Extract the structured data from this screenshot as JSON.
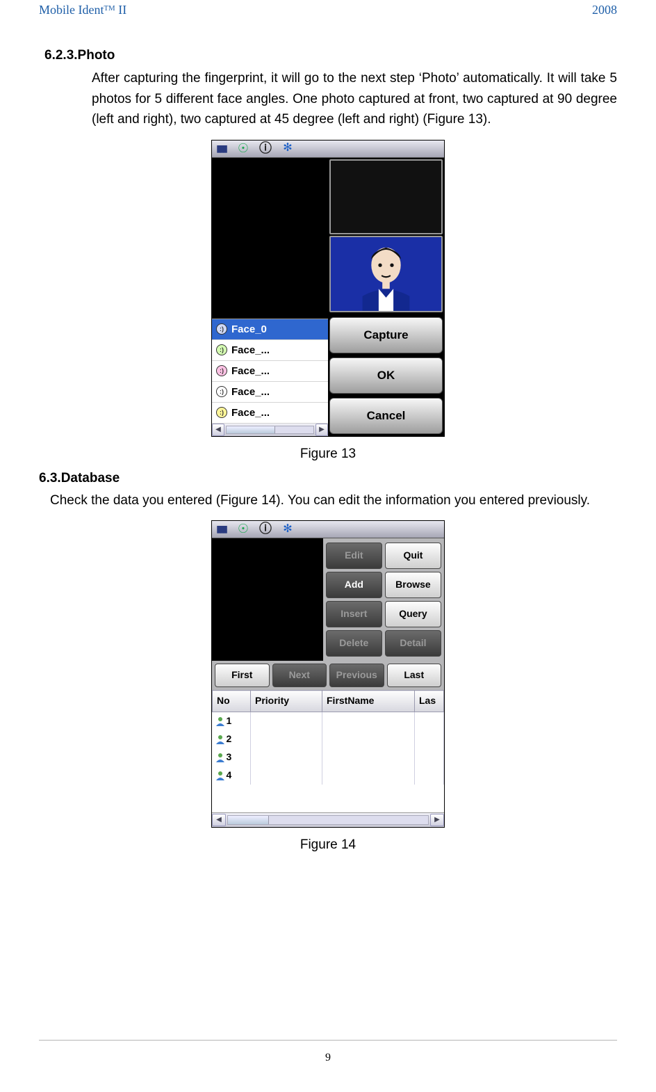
{
  "header": {
    "title_left": "Mobile Identᵀᴹ II",
    "title_right": "2008"
  },
  "section623": {
    "heading": "6.2.3.Photo",
    "body": "After capturing the fingerprint, it will go to the next step ‘Photo’ automatically. It will take 5 photos for 5 different face angles. One photo captured at front, two captured at 90 degree (left and right), two captured at 45 degree (left and right) (Figure 13)."
  },
  "figure13": {
    "caption": "Figure 13",
    "face_list": [
      "Face_0",
      "Face_...",
      "Face_...",
      "Face_...",
      "Face_..."
    ],
    "buttons": {
      "capture": "Capture",
      "ok": "OK",
      "cancel": "Cancel"
    }
  },
  "section63": {
    "heading": "6.3.Database",
    "body": "Check the data you entered (Figure 14). You can edit the information you entered previously."
  },
  "figure14": {
    "caption": "Figure 14",
    "top_buttons": {
      "edit": "Edit",
      "quit": "Quit",
      "add": "Add",
      "browse": "Browse",
      "insert": "Insert",
      "query": "Query",
      "delete": "Delete",
      "detail": "Detail"
    },
    "nav_buttons": {
      "first": "First",
      "next": "Next",
      "previous": "Previous",
      "last": "Last"
    },
    "table": {
      "headers": [
        "No",
        "Priority",
        "FirstName",
        "Las"
      ],
      "rows": [
        {
          "no": "1"
        },
        {
          "no": "2"
        },
        {
          "no": "3"
        },
        {
          "no": "4"
        }
      ]
    }
  },
  "footer": {
    "page_number": "9"
  }
}
